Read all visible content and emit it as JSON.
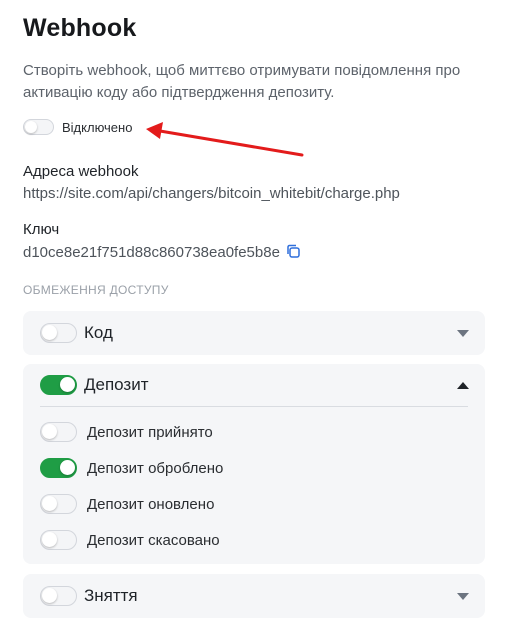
{
  "webhook": {
    "title": "Webhook",
    "description": "Створіть webhook, щоб миттєво отримувати повідомлення про активацію коду або підтвердження депозиту.",
    "enabled": false,
    "status_label": "Відключено"
  },
  "address": {
    "label": "Адреса webhook",
    "value": "https://site.com/api/changers/bitcoin_whitebit/charge.php"
  },
  "key": {
    "label": "Ключ",
    "value": "d10ce8e21f751d88c860738ea0fe5b8e"
  },
  "access": {
    "caption": "ОБМЕЖЕННЯ ДОСТУПУ",
    "code": {
      "label": "Код",
      "enabled": false,
      "expanded": false
    },
    "deposit": {
      "label": "Депозит",
      "enabled": true,
      "expanded": true,
      "items": [
        {
          "label": "Депозит прийнято",
          "enabled": false
        },
        {
          "label": "Депозит оброблено",
          "enabled": true
        },
        {
          "label": "Депозит оновлено",
          "enabled": false
        },
        {
          "label": "Депозит скасовано",
          "enabled": false
        }
      ]
    },
    "withdrawal": {
      "label": "Зняття",
      "enabled": false,
      "expanded": false
    }
  },
  "colors": {
    "toggle_on": "#1f9d45",
    "annotation_arrow": "#e31b1b",
    "link_icon": "#2f6fdb"
  }
}
